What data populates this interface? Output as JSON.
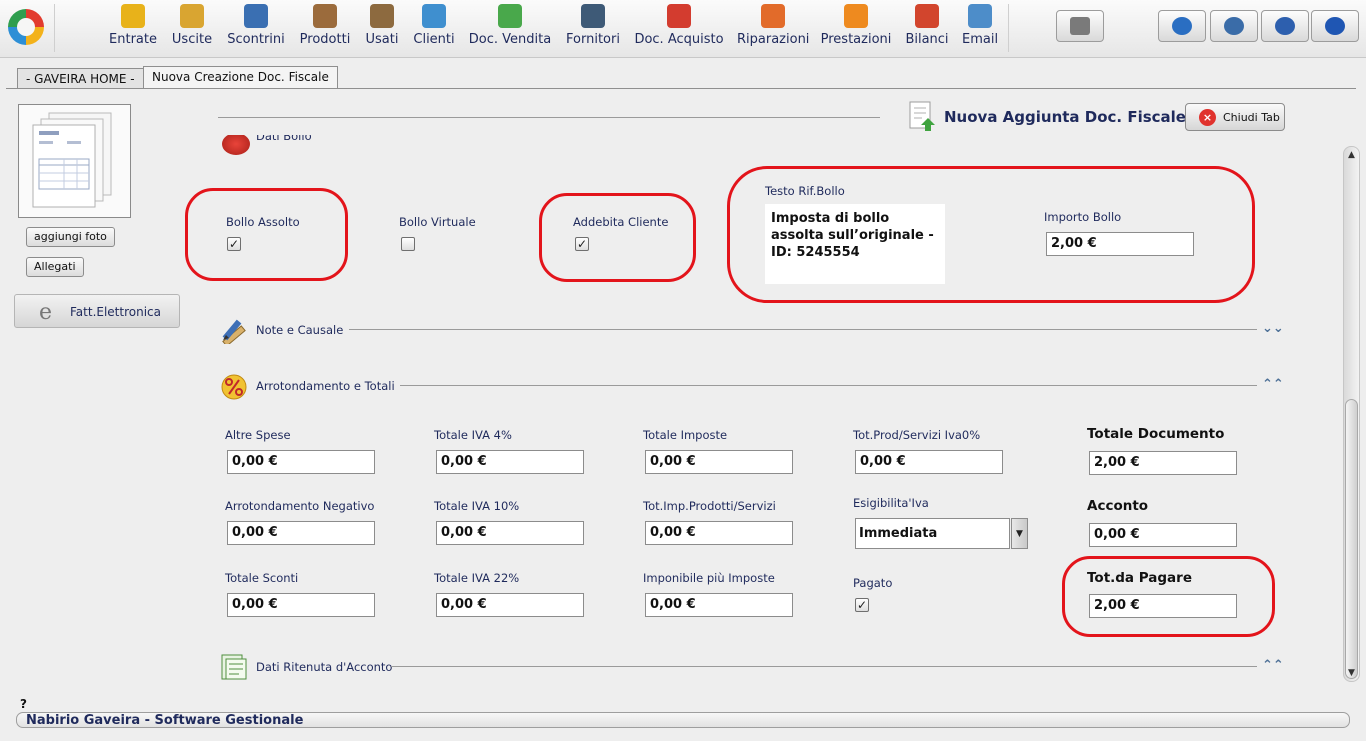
{
  "toolbar": {
    "items": [
      {
        "label": "Entrate",
        "icon": "coin-in-icon",
        "color": "#e8b21a"
      },
      {
        "label": "Uscite",
        "icon": "coin-out-icon",
        "color": "#d9a531"
      },
      {
        "label": "Scontrini",
        "icon": "receipt-icon",
        "color": "#3a6fb2"
      },
      {
        "label": "Prodotti",
        "icon": "boxes-icon",
        "color": "#9b6b3c"
      },
      {
        "label": "Usati",
        "icon": "box-icon",
        "color": "#8d6a3f"
      },
      {
        "label": "Clienti",
        "icon": "customer-icon",
        "color": "#3f8fcf"
      },
      {
        "label": "Doc. Vendita",
        "icon": "sale-document-icon",
        "color": "#49a84b"
      },
      {
        "label": "Fornitori",
        "icon": "building-icon",
        "color": "#3e5a77"
      },
      {
        "label": "Doc. Acquisto",
        "icon": "purchase-document-icon",
        "color": "#d33c2f"
      },
      {
        "label": "Riparazioni",
        "icon": "repair-icon",
        "color": "#e26b2a"
      },
      {
        "label": "Prestazioni",
        "icon": "service-icon",
        "color": "#ee8a1f"
      },
      {
        "label": "Bilanci",
        "icon": "balance-icon",
        "color": "#d2452d"
      },
      {
        "label": "Email",
        "icon": "email-icon",
        "color": "#4d8dc9"
      }
    ],
    "right_buttons": [
      {
        "icon": "cash-register-icon",
        "color": "#7a7a7a"
      },
      {
        "icon": "keyboard-icon",
        "color": "#2a6ec2"
      },
      {
        "icon": "settings-icon",
        "color": "#3a6ca8"
      },
      {
        "icon": "minimize-icon",
        "color": "#2d5fae"
      },
      {
        "icon": "power-icon",
        "color": "#1f56b3"
      }
    ]
  },
  "tabs": [
    {
      "label": "- GAVEIRA HOME -"
    },
    {
      "label": "Nuova Creazione Doc. Fiscale"
    }
  ],
  "left_panel": {
    "add_photo_label": "aggiungi foto",
    "attachments_label": "Allegati",
    "e_invoice_label": "Fatt.Elettronica",
    "e_invoice_icon": "e"
  },
  "header": {
    "title": "Nuova Aggiunta Doc. Fiscale",
    "close_label": "Chiudi Tab",
    "close_icon": "×"
  },
  "bollo": {
    "section_label": "Dati Bollo",
    "assolto_label": "Bollo Assolto",
    "assolto_checked": true,
    "virtuale_label": "Bollo Virtuale",
    "virtuale_checked": false,
    "addebita_label": "Addebita Cliente",
    "addebita_checked": true,
    "testo_label": "Testo Rif.Bollo",
    "testo_value": "Imposta di bollo assolta sull’originale - ID: 5245554",
    "importo_label": "Importo Bollo",
    "importo_value": "2,00 €"
  },
  "sections": {
    "note_label": "Note e Causale",
    "totali_label": "Arrotondamento e Totali",
    "ritenuta_label": "Dati Ritenuta d'Acconto",
    "chev_down": "⌄⌄",
    "chev_up": "⌃⌃"
  },
  "totali": {
    "altre_spese": {
      "label": "Altre Spese",
      "value": "0,00 €"
    },
    "totale_iva_4": {
      "label": "Totale IVA  4%",
      "value": "0,00 €"
    },
    "totale_imposte": {
      "label": "Totale Imposte",
      "value": "0,00 €"
    },
    "tot_prod_iva0": {
      "label": "Tot.Prod/Servizi Iva0%",
      "value": "0,00 €"
    },
    "totale_documento": {
      "label": "Totale Documento",
      "value": "2,00 €"
    },
    "arrotondamento_negativo": {
      "label": "Arrotondamento Negativo",
      "value": "0,00 €"
    },
    "totale_iva_10": {
      "label": "Totale IVA  10%",
      "value": "0,00 €"
    },
    "tot_imp_prodotti": {
      "label": "Tot.Imp.Prodotti/Servizi",
      "value": "0,00 €"
    },
    "esigibilita": {
      "label": "Esigibilita'Iva",
      "value": "Immediata"
    },
    "acconto": {
      "label": "Acconto",
      "value": "0,00 €"
    },
    "totale_sconti": {
      "label": "Totale Sconti",
      "value": "0,00 €"
    },
    "totale_iva_22": {
      "label": "Totale IVA  22%",
      "value": "0,00 €"
    },
    "imponibile_imposte": {
      "label": "Imponibile più Imposte",
      "value": "0,00 €"
    },
    "pagato": {
      "label": "Pagato",
      "checked": true
    },
    "tot_da_pagare": {
      "label": "Tot.da Pagare",
      "value": "2,00 €"
    }
  },
  "status": {
    "help": "?",
    "text": "Nabirio Gaveira - Software Gestionale"
  },
  "colors": {
    "highlight": "#e3141b",
    "label_text": "#1f2a5c"
  }
}
